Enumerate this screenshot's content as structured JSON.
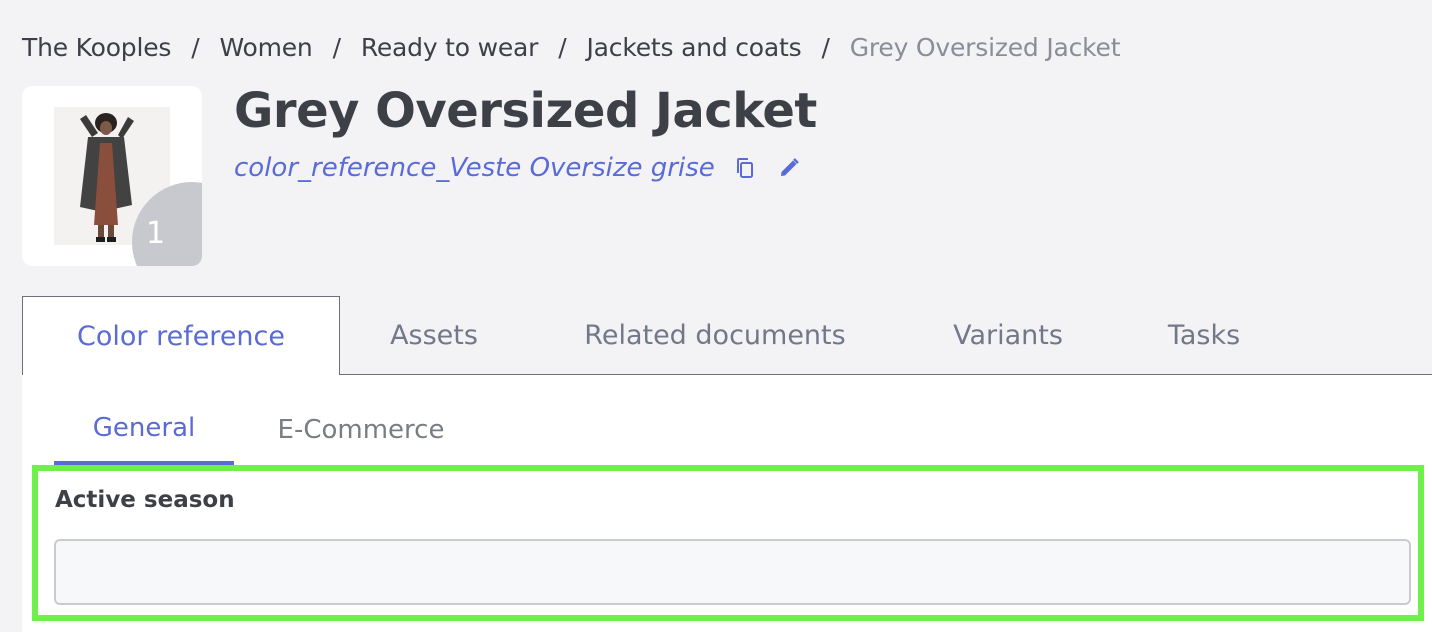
{
  "breadcrumb": {
    "items": [
      "The Kooples",
      "Women",
      "Ready to wear",
      "Jackets and coats"
    ],
    "current": "Grey Oversized Jacket",
    "separator": "/"
  },
  "product": {
    "image_count": "1",
    "title": "Grey Oversized Jacket",
    "reference": "color_reference_Veste Oversize grise",
    "icons": [
      "copy-icon",
      "edit-pencil-icon"
    ]
  },
  "tabs": [
    {
      "label": "Color reference",
      "active": true
    },
    {
      "label": "Assets",
      "active": false
    },
    {
      "label": "Related documents",
      "active": false
    },
    {
      "label": "Variants",
      "active": false
    },
    {
      "label": "Tasks",
      "active": false
    }
  ],
  "subtabs": [
    {
      "label": "General",
      "active": true
    },
    {
      "label": "E-Commerce",
      "active": false
    }
  ],
  "form": {
    "active_season": {
      "label": "Active season",
      "value": "",
      "placeholder": ""
    }
  },
  "colors": {
    "accent": "#5a6bd6",
    "highlight": "#6ef04a",
    "background": "#f3f3f6",
    "text": "#3d4147"
  }
}
